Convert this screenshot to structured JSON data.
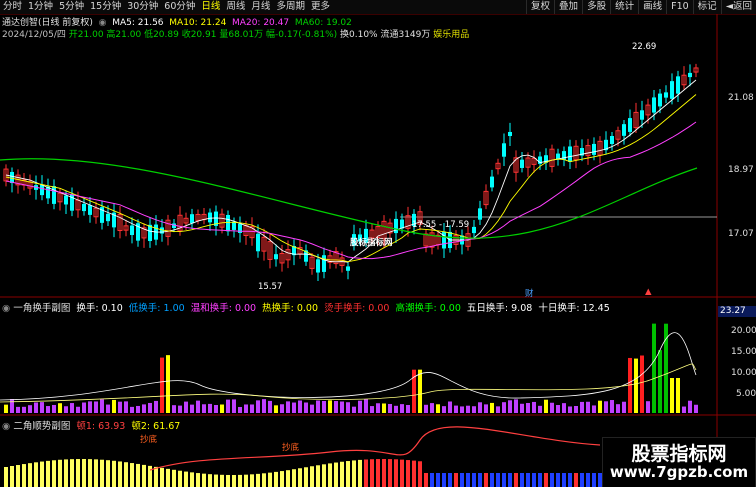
{
  "toolbar": {
    "periods": [
      "分时",
      "1分钟",
      "5分钟",
      "15分钟",
      "30分钟",
      "60分钟",
      "日线",
      "周线",
      "月线",
      "多周期",
      "更多"
    ],
    "selected": "日线",
    "right_buttons": [
      "复权",
      "叠加",
      "多股",
      "统计",
      "画线",
      "F10",
      "标记",
      "◄返回"
    ]
  },
  "info1": {
    "title": "通达创智(日线 前复权)",
    "ma5": "MA5: 21.56",
    "ma10": "MA10: 21.24",
    "ma20": "MA20: 20.47",
    "ma60": "MA60: 19.02"
  },
  "info2": {
    "date": "2024/12/05/四",
    "open": "开21.00",
    "high": "高21.00",
    "low": "低20.89",
    "close": "收20.91",
    "volume": "量68.01万",
    "change": "幅-0.17(-0.81%)",
    "turnover": "换0.10%",
    "float": "流通3149万",
    "sector": "娱乐用品"
  },
  "price_axis": [
    "21.08",
    "18.97",
    "17.07"
  ],
  "annotations": {
    "high": "22.69",
    "low": "15.57",
    "range": "17.55 - 17.59",
    "wm_center": "股标指标网",
    "cai": "财",
    "flag": "▲"
  },
  "sub1": {
    "title": "一角换手副图",
    "items": [
      {
        "label": "换手: 0.10",
        "color": "#ffffff"
      },
      {
        "label": "低换手: 1.00",
        "color": "#00a0ff"
      },
      {
        "label": "温和换手: 0.00",
        "color": "#ff40ff"
      },
      {
        "label": "热换手: 0.00",
        "color": "#ffff00"
      },
      {
        "label": "烫手换手: 0.00",
        "color": "#ff3030"
      },
      {
        "label": "高潮换手: 0.00",
        "color": "#00ff00"
      },
      {
        "label": "五日换手: 9.08",
        "color": "#ffffff"
      },
      {
        "label": "十日换手: 12.45",
        "color": "#ffffff"
      }
    ],
    "axis": [
      "23.27",
      "20.00",
      "15.00",
      "10.00",
      "5.00"
    ]
  },
  "sub2": {
    "title": "二角顺势副图",
    "v1": "顿1: 63.93",
    "v2": "顿2: 61.67",
    "labels": [
      "抄底",
      "抄底"
    ]
  },
  "watermark": {
    "line1": "股票指标网",
    "line2": "www.7gpzb.com"
  },
  "colors": {
    "up": "#ff3232",
    "down": "#00ffff",
    "ma5": "#ffffff",
    "ma10": "#ffff00",
    "ma20": "#ff40ff",
    "ma60": "#00d000"
  }
}
